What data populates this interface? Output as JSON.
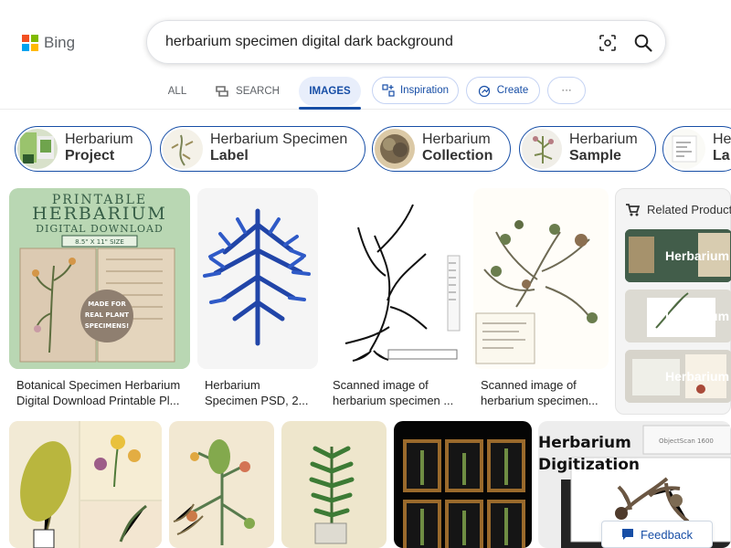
{
  "logo": {
    "text": "Bing"
  },
  "search": {
    "query": "herbarium specimen digital dark background"
  },
  "nav": {
    "tabs": [
      {
        "label": "ALL",
        "active": false
      },
      {
        "label": "SEARCH",
        "active": false
      },
      {
        "label": "IMAGES",
        "active": true
      },
      {
        "label": "Inspiration",
        "active": false
      },
      {
        "label": "Create",
        "active": false
      },
      {
        "label": "···",
        "active": false
      }
    ]
  },
  "chips": [
    {
      "line1": "Herbarium",
      "line2": "Project"
    },
    {
      "line1": "Herbarium Specimen",
      "line2": "Label"
    },
    {
      "line1": "Herbarium",
      "line2": "Collection"
    },
    {
      "line1": "Herbarium",
      "line2": "Sample"
    },
    {
      "line1": "He",
      "line2": "La"
    }
  ],
  "results": [
    {
      "title": "Botanical Specimen Herbarium",
      "subtitle": "Digital Download Printable Pl...",
      "thumb_text": [
        "PRINTABLE",
        "HERBARIUM",
        "DIGITAL DOWNLOAD",
        "8.5\" X 11\" SIZE",
        "MADE FOR",
        "REAL PLANT",
        "SPECIMENS!"
      ]
    },
    {
      "title": "Herbarium",
      "subtitle": "Specimen PSD, 2..."
    },
    {
      "title": "Scanned image of",
      "subtitle": "herbarium specimen ..."
    },
    {
      "title": "Scanned image of",
      "subtitle": "herbarium specimen..."
    }
  ],
  "related": {
    "title": "Related Product",
    "items": [
      {
        "label": "Herbarium"
      },
      {
        "label": "Herbarium"
      },
      {
        "label": "Herbarium P"
      }
    ]
  },
  "bottom_results": [
    {
      "name": "botanical-plates"
    },
    {
      "name": "herb-illustration"
    },
    {
      "name": "fern-illustration"
    },
    {
      "name": "framed-specimens"
    },
    {
      "name": "herbarium-digitization",
      "overlay": [
        "Herbarium",
        "Digitization"
      ],
      "device_text": "ObjectScan 1600"
    }
  ],
  "feedback": {
    "label": "Feedback"
  },
  "colors": {
    "accent": "#174ea6",
    "bing_red": "#f25022",
    "bing_green": "#7fba00",
    "bing_blue": "#00a4ef",
    "bing_yellow": "#ffb900"
  }
}
